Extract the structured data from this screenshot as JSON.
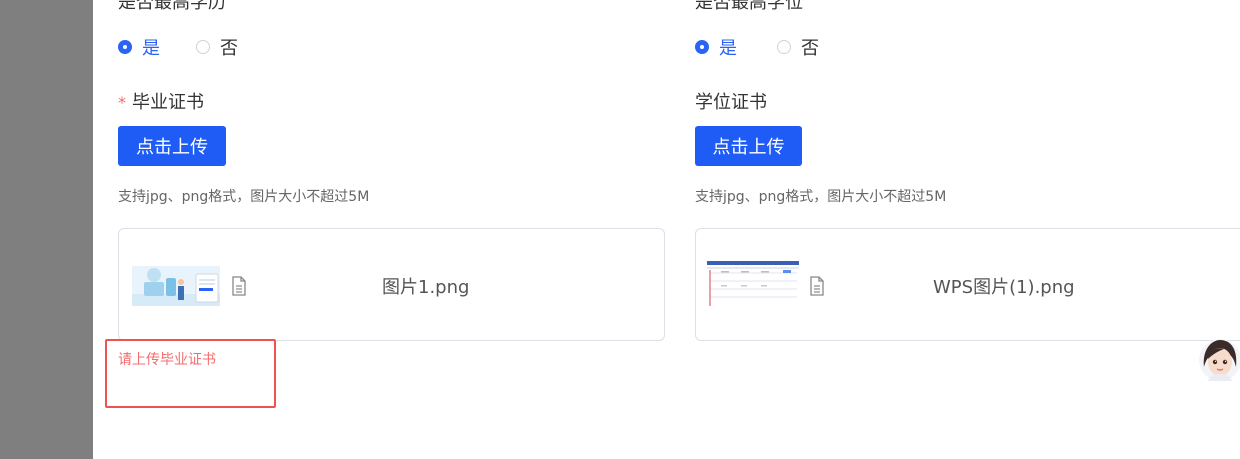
{
  "left": {
    "top_label": "是否最高学历",
    "radio_yes": "是",
    "radio_no": "否",
    "required_mark": "*",
    "cert_label": "毕业证书",
    "upload_button": "点击上传",
    "hint": "支持jpg、png格式，图片大小不超过5M",
    "file_name": "图片1.png",
    "error": "请上传毕业证书",
    "selected": "是"
  },
  "right": {
    "top_label": "是否最高学位",
    "radio_yes": "是",
    "radio_no": "否",
    "cert_label": "学位证书",
    "upload_button": "点击上传",
    "hint": "支持jpg、png格式，图片大小不超过5M",
    "file_name": "WPS图片(1).png",
    "selected": "是"
  },
  "colors": {
    "primary": "#1e5cf5",
    "error": "#f56c6c",
    "highlight_box": "#f05252",
    "overlay": "#7f7f7f"
  },
  "icons": [
    "document-icon",
    "assistant-avatar-icon",
    "image-thumbnail"
  ]
}
